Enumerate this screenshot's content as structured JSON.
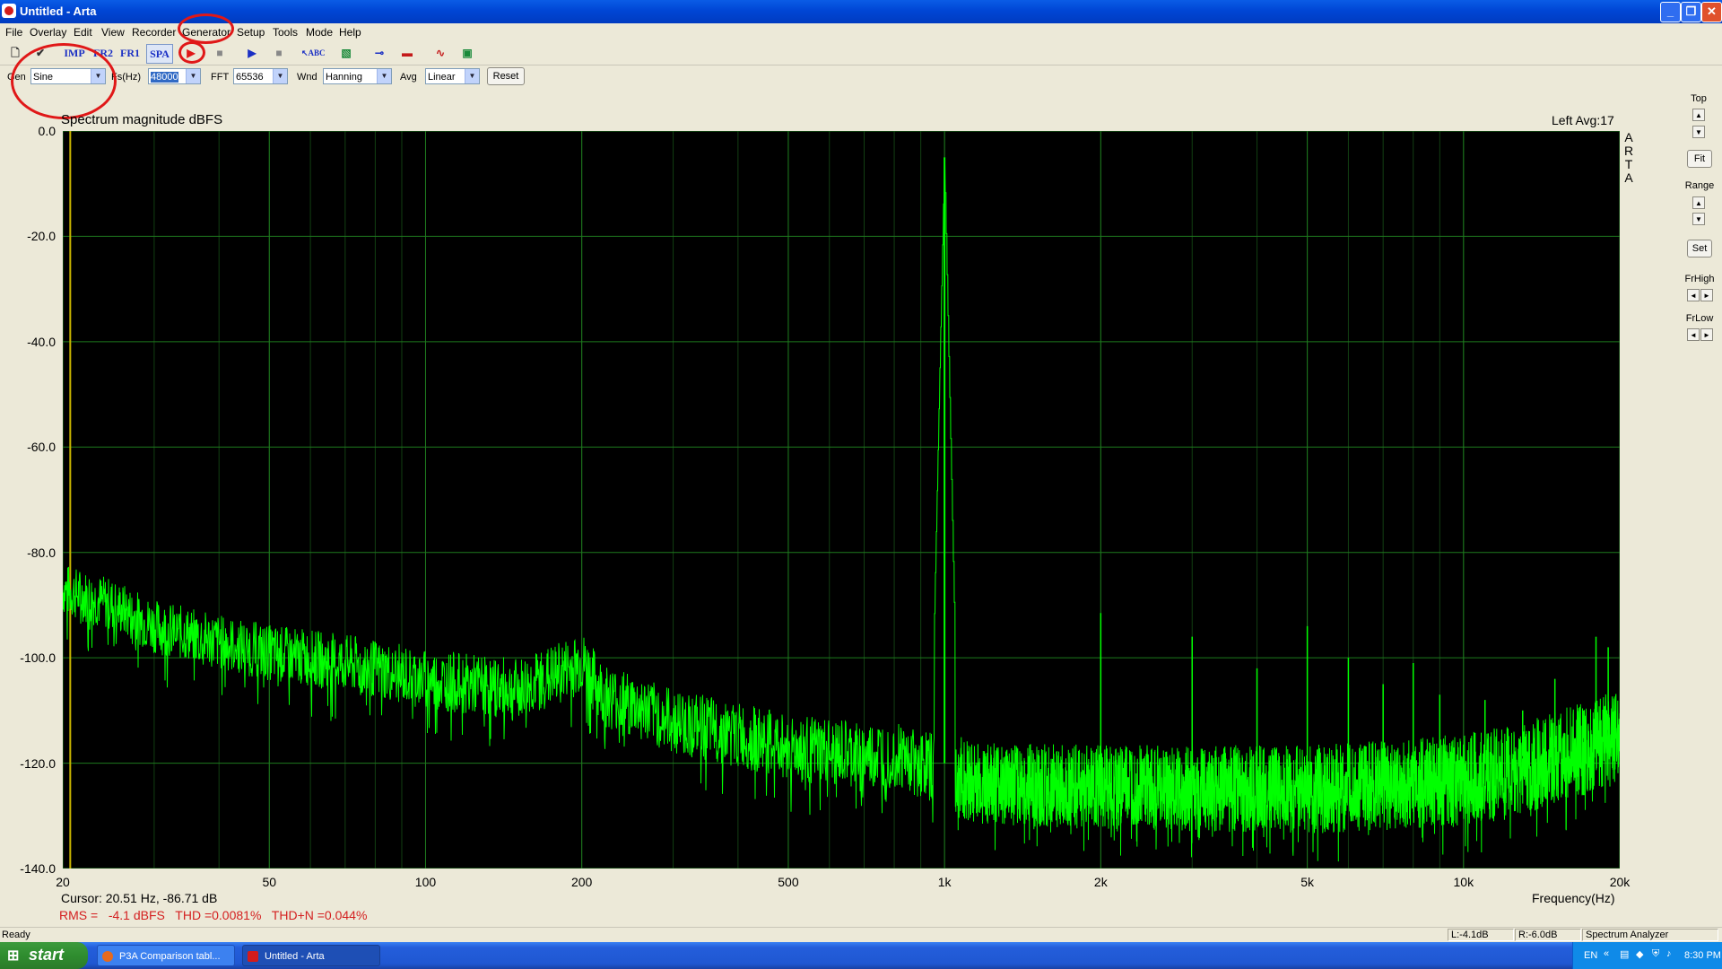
{
  "window": {
    "title": "Untitled - Arta"
  },
  "menu": [
    "File",
    "Overlay",
    "Edit",
    "View",
    "Recorder",
    "Generator",
    "Setup",
    "Tools",
    "Mode",
    "Help"
  ],
  "toolbar": {
    "imp": "IMP",
    "fr2": "FR2",
    "fr1": "FR1",
    "spa": "SPA"
  },
  "controls": {
    "gen_label": "Gen",
    "gen_value": "Sine",
    "fs_label": "Fs(Hz)",
    "fs_value": "48000",
    "fft_label": "FFT",
    "fft_value": "65536",
    "wnd_label": "Wnd",
    "wnd_value": "Hanning",
    "avg_label": "Avg",
    "avg_value": "Linear",
    "reset_label": "Reset"
  },
  "right_panel": {
    "top": "Top",
    "fit": "Fit",
    "range": "Range",
    "set": "Set",
    "frhigh": "FrHigh",
    "frlow": "FrLow"
  },
  "chart_data": {
    "type": "line",
    "title": "Spectrum magnitude dBFS",
    "meta": "Left  Avg:17",
    "logo": [
      "A",
      "R",
      "T",
      "A"
    ],
    "xlabel": "Frequency(Hz)",
    "x_scale": "log",
    "xlim": [
      20,
      20000
    ],
    "ylim": [
      -140,
      0
    ],
    "yticks": [
      "0.0",
      "-20.0",
      "-40.0",
      "-60.0",
      "-80.0",
      "-100.0",
      "-120.0",
      "-140.0"
    ],
    "xticks": [
      {
        "v": 20,
        "t": "20"
      },
      {
        "v": 50,
        "t": "50"
      },
      {
        "v": 100,
        "t": "100"
      },
      {
        "v": 200,
        "t": "200"
      },
      {
        "v": 500,
        "t": "500"
      },
      {
        "v": 1000,
        "t": "1k"
      },
      {
        "v": 2000,
        "t": "2k"
      },
      {
        "v": 5000,
        "t": "5k"
      },
      {
        "v": 10000,
        "t": "10k"
      },
      {
        "v": 20000,
        "t": "20k"
      }
    ],
    "grid": true,
    "background": "#000000",
    "trace_color": "#00ff00",
    "grid_color": "#1e7a1e",
    "noise_floor": [
      [
        20,
        -87
      ],
      [
        25,
        -90
      ],
      [
        30,
        -94
      ],
      [
        40,
        -97
      ],
      [
        50,
        -99
      ],
      [
        70,
        -101
      ],
      [
        100,
        -104
      ],
      [
        150,
        -106
      ],
      [
        180,
        -103
      ],
      [
        200,
        -101
      ],
      [
        220,
        -107
      ],
      [
        300,
        -112
      ],
      [
        500,
        -117
      ],
      [
        700,
        -119
      ],
      [
        800,
        -118
      ],
      [
        900,
        -120
      ],
      [
        1000,
        -122
      ],
      [
        1200,
        -124
      ],
      [
        2000,
        -124.5
      ],
      [
        5000,
        -125
      ],
      [
        8000,
        -124
      ],
      [
        10000,
        -123
      ],
      [
        14000,
        -120
      ],
      [
        20000,
        -115
      ]
    ],
    "peak": {
      "x": 1000,
      "y": -5
    },
    "harmonics": [
      {
        "x": 2000,
        "y": -91.5
      },
      {
        "x": 3000,
        "y": -96
      },
      {
        "x": 4000,
        "y": -102
      },
      {
        "x": 5000,
        "y": -94
      },
      {
        "x": 6000,
        "y": -100
      },
      {
        "x": 7000,
        "y": -105
      },
      {
        "x": 8000,
        "y": -101
      },
      {
        "x": 9000,
        "y": -107
      },
      {
        "x": 11000,
        "y": -108
      },
      {
        "x": 13000,
        "y": -110
      },
      {
        "x": 15000,
        "y": -104
      },
      {
        "x": 17000,
        "y": -110
      },
      {
        "x": 18000,
        "y": -96
      },
      {
        "x": 19000,
        "y": -98
      }
    ],
    "cursor": {
      "x": 20.51,
      "y": -86.71
    },
    "cursor_readout": "Cursor: 20.51 Hz, -86.71 dB",
    "measurements": "RMS =   -4.1 dBFS   THD =0.0081%   THD+N =0.044%"
  },
  "statusbar": {
    "ready": "Ready",
    "left": "L:-4.1dB",
    "right": "R:-6.0dB",
    "mode": "Spectrum Analyzer"
  },
  "taskbar": {
    "start": "start",
    "tasks": [
      "P3A Comparison tabl...",
      "Untitled - Arta"
    ],
    "lang": "EN",
    "time": "8:30 PM"
  }
}
